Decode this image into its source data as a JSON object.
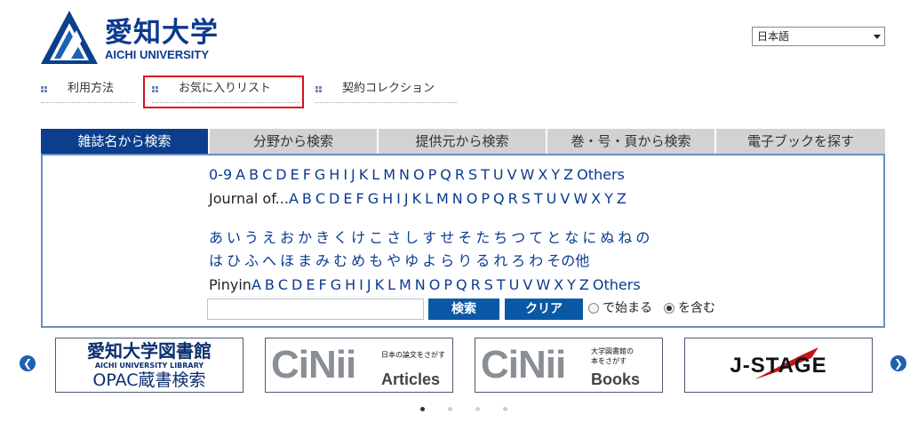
{
  "header": {
    "logo_jp": "愛知大学",
    "logo_en": "AICHI UNIVERSITY",
    "language": "日本語"
  },
  "top_links": [
    {
      "label": "利用方法"
    },
    {
      "label": "お気に入りリスト"
    },
    {
      "label": "契約コレクション"
    }
  ],
  "tabs": [
    {
      "label": "雑誌名から検索",
      "active": true
    },
    {
      "label": "分野から検索"
    },
    {
      "label": "提供元から検索"
    },
    {
      "label": "巻・号・頁から検索"
    },
    {
      "label": "電子ブックを探す"
    }
  ],
  "browse": {
    "row1": [
      "0-9",
      "A",
      "B",
      "C",
      "D",
      "E",
      "F",
      "G",
      "H",
      "I",
      "J",
      "K",
      "L",
      "M",
      "N",
      "O",
      "P",
      "Q",
      "R",
      "S",
      "T",
      "U",
      "V",
      "W",
      "X",
      "Y",
      "Z",
      "Others"
    ],
    "row2_prefix": "Journal of...",
    "row2": [
      "A",
      "B",
      "C",
      "D",
      "E",
      "F",
      "G",
      "H",
      "I",
      "J",
      "K",
      "L",
      "M",
      "N",
      "O",
      "P",
      "Q",
      "R",
      "S",
      "T",
      "U",
      "V",
      "W",
      "X",
      "Y",
      "Z"
    ],
    "kana1": [
      "あ",
      "い",
      "う",
      "え",
      "お",
      "か",
      "き",
      "く",
      "け",
      "こ",
      "さ",
      "し",
      "す",
      "せ",
      "そ",
      "た",
      "ち",
      "つ",
      "て",
      "と",
      "な",
      "に",
      "ぬ",
      "ね",
      "の"
    ],
    "kana2": [
      "は",
      "ひ",
      "ふ",
      "へ",
      "ほ",
      "ま",
      "み",
      "む",
      "め",
      "も",
      "や",
      "ゆ",
      "よ",
      "ら",
      "り",
      "る",
      "れ",
      "ろ",
      "わ",
      "その他"
    ],
    "pinyin_prefix": "Pinyin",
    "pinyin": [
      "A",
      "B",
      "C",
      "D",
      "E",
      "F",
      "G",
      "H",
      "I",
      "J",
      "K",
      "L",
      "M",
      "N",
      "O",
      "P",
      "Q",
      "R",
      "S",
      "T",
      "U",
      "V",
      "W",
      "X",
      "Y",
      "Z",
      "Others"
    ]
  },
  "search": {
    "input_value": "",
    "search_label": "検索",
    "clear_label": "クリア",
    "radio_starts": "で始まる",
    "radio_contains": "を含む",
    "selected": "contains"
  },
  "banners": {
    "library": {
      "line1": "愛知大学図書館",
      "line2": "AICHI UNIVERSITY LIBRARY",
      "line3": "OPAC蔵書検索"
    },
    "cinii_articles": {
      "logo": "CiNii",
      "tagline": "日本の論文をさがす",
      "name": "Articles"
    },
    "cinii_books": {
      "logo": "CiNii",
      "tagline_1": "大学図書館の",
      "tagline_2": "本をさがす",
      "name": "Books"
    },
    "jstage": {
      "logo": "J-STAGE"
    }
  },
  "carousel": {
    "pages": 4,
    "current": 1
  }
}
